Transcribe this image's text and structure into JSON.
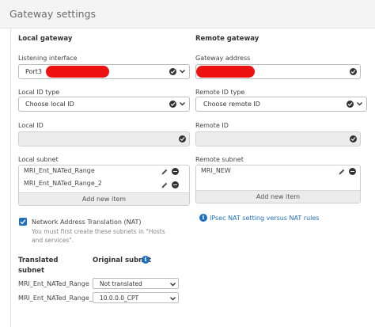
{
  "page": {
    "title": "Gateway settings"
  },
  "local": {
    "heading": "Local gateway",
    "listening_interface_label": "Listening interface",
    "listening_interface_value": "Port3",
    "local_id_type_label": "Local ID type",
    "local_id_type_value": "Choose local ID",
    "local_id_label": "Local ID",
    "local_subnet_label": "Local subnet",
    "subnets": [
      "MRI_Ent_NATed_Range",
      "MRI_Ent_NATed_Range_2"
    ],
    "add_new_item": "Add new item"
  },
  "remote": {
    "heading": "Remote gateway",
    "gateway_address_label": "Gateway address",
    "remote_id_type_label": "Remote ID type",
    "remote_id_type_value": "Choose remote ID",
    "remote_id_label": "Remote ID",
    "remote_subnet_label": "Remote subnet",
    "subnets": [
      "MRI_NEW"
    ],
    "add_new_item": "Add new item",
    "nat_link": "IPsec NAT setting versus NAT rules"
  },
  "nat": {
    "checkbox_label": "Network Address Translation (NAT)",
    "checked": true,
    "hint_line1": "You must first create these subnets in \"Hosts",
    "hint_line2": "and services\".",
    "translated_subnet_line1": "Translated",
    "translated_subnet_line2": "subnet",
    "original_subnet": "Original subnet",
    "rows": [
      {
        "name": "MRI_Ent_NATed_Range",
        "value": "Not translated"
      },
      {
        "name": "MRI_Ent_NATed_Range_2",
        "value": "10.0.0.0_CPT"
      }
    ]
  },
  "colors": {
    "accent": "#1f6fbf",
    "redaction": "#ee1111"
  },
  "icons": {
    "check": "check-circle-icon",
    "dropdown": "chevron-down-icon",
    "edit": "pencil-icon",
    "remove": "minus-circle-icon",
    "info": "info-icon"
  }
}
